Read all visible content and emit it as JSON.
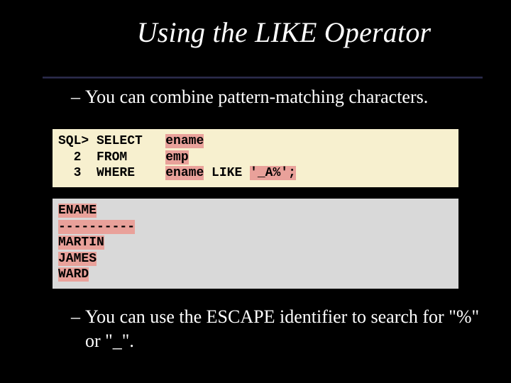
{
  "title": "Using the LIKE Operator",
  "bullets": {
    "b1": "You can combine pattern-matching characters.",
    "b2": "You can use the ESCAPE identifier to search for \"%\" or \"_\"."
  },
  "dash": "–",
  "sql": {
    "line1_prompt": "SQL> SELECT   ",
    "line1_col": "ename",
    "line2_prompt": "  2  FROM     ",
    "line2_tbl": "emp",
    "line3_prompt": "  3  WHERE    ",
    "line3_col": "ename",
    "line3_mid": " LIKE ",
    "line3_pat": "'_A%';"
  },
  "result": {
    "header": "ENAME",
    "sep": "----------",
    "r1": "MARTIN",
    "r2": "JAMES",
    "r3": "WARD"
  }
}
